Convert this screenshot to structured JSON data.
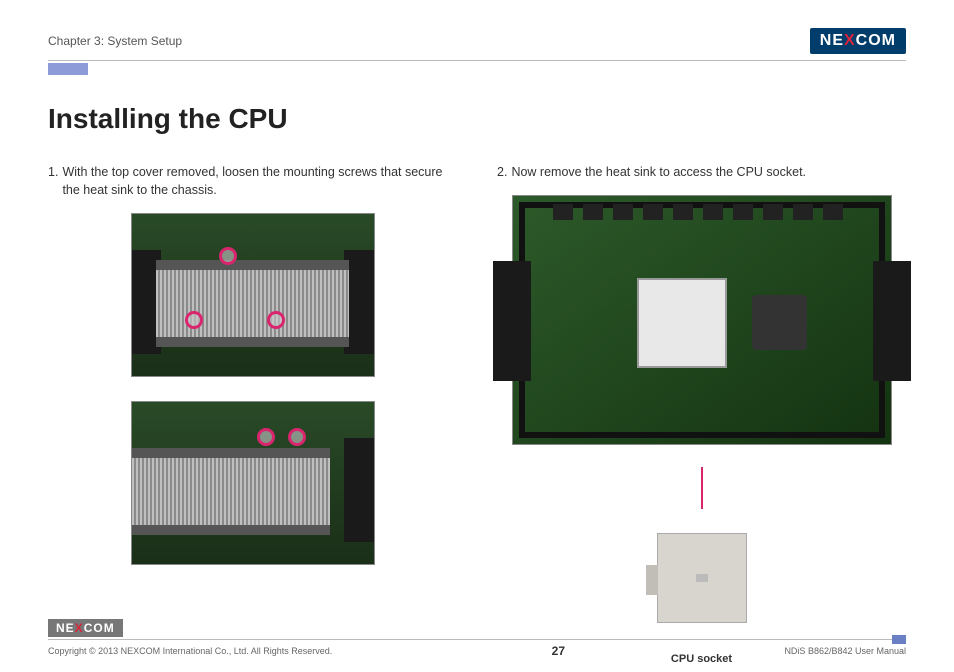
{
  "header": {
    "chapter": "Chapter 3: System Setup",
    "logo_left": "NE",
    "logo_x": "X",
    "logo_right": "COM"
  },
  "title": "Installing the CPU",
  "steps": {
    "s1_num": "1.",
    "s1_text": "With the top cover removed, loosen the mounting screws that secure the heat sink to the chassis.",
    "s2_num": "2.",
    "s2_text": "Now remove the heat sink to access the CPU socket."
  },
  "labels": {
    "cpu_socket": "CPU socket"
  },
  "footer": {
    "copyright": "Copyright © 2013 NEXCOM International Co., Ltd. All Rights Reserved.",
    "page": "27",
    "manual": "NDiS B862/B842 User Manual"
  }
}
